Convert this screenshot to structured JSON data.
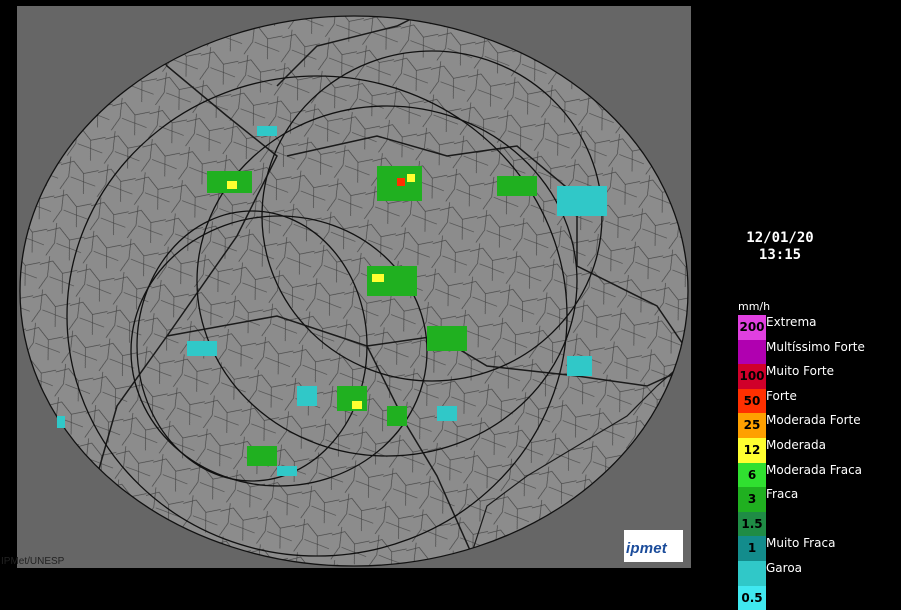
{
  "timestamp": {
    "date": "12/01/20",
    "time": "13:15"
  },
  "legend": {
    "unit": "mm/h",
    "levels": [
      {
        "value": "200",
        "label": "Extrema",
        "color": "#e040e0"
      },
      {
        "value": "",
        "label": "Multíssimo Forte",
        "color": "#b000b0"
      },
      {
        "value": "100",
        "label": "Muito Forte",
        "color": "#d0002a"
      },
      {
        "value": "50",
        "label": "Forte",
        "color": "#ff3000"
      },
      {
        "value": "25",
        "label": "Moderada Forte",
        "color": "#ffa000"
      },
      {
        "value": "12",
        "label": "Moderada",
        "color": "#ffff30"
      },
      {
        "value": "6",
        "label": "Moderada Fraca",
        "color": "#30e030"
      },
      {
        "value": "3",
        "label": "Fraca",
        "color": "#20b020"
      },
      {
        "value": "1.5",
        "label": "",
        "color": "#1f8c45"
      },
      {
        "value": "1",
        "label": "Muito Fraca",
        "color": "#138c8c"
      },
      {
        "value": "",
        "label": "Garoa",
        "color": "#30c8c8"
      },
      {
        "value": "0.5",
        "label": "",
        "color": "#40e8f0"
      }
    ]
  },
  "credit": "IPMet/UNESP",
  "logo": {
    "text": "ipmet"
  },
  "colors": {
    "background": "#000000",
    "map_land": "#8c8c8c",
    "map_outside": "#666666",
    "borders": "#1a1a1a"
  }
}
